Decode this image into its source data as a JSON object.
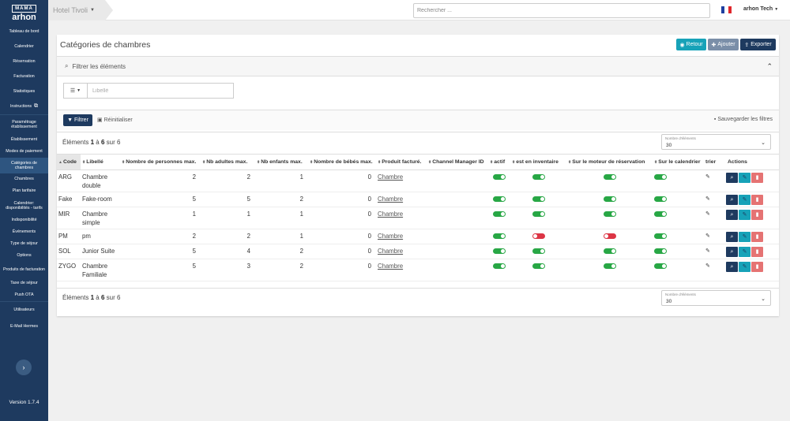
{
  "brand": {
    "line1": "MAMA",
    "line2": "arhon"
  },
  "sidebar": {
    "items": [
      {
        "label": "Tableau de bord",
        "height": 20
      },
      {
        "label": "Calendrier",
        "height": 19
      },
      {
        "label": "Réservation",
        "height": 19
      },
      {
        "label": "Facturation",
        "height": 19
      },
      {
        "label": "Statistiques",
        "height": 19
      },
      {
        "label": "Instructions",
        "height": 19,
        "icon": true
      },
      {
        "label": "Paramétrage établissement",
        "height": 25
      },
      {
        "label": "Établissement",
        "height": 15
      },
      {
        "label": "Modes de paiement",
        "height": 15
      },
      {
        "label": "Catégories de chambres",
        "height": 20
      },
      {
        "label": "Chambres",
        "height": 15
      },
      {
        "label": "Plan tarifaire",
        "height": 15
      },
      {
        "label": "Calendrier: disponibilités - tarifs",
        "height": 22
      },
      {
        "label": "Indisponibilité",
        "height": 15
      },
      {
        "label": "Événements",
        "height": 15
      },
      {
        "label": "Type de séjour",
        "height": 15
      },
      {
        "label": "Options",
        "height": 15
      },
      {
        "label": "Produits de facturation",
        "height": 20
      },
      {
        "label": "Taxe de séjour",
        "height": 15
      },
      {
        "label": "Push OTA",
        "height": 15
      },
      {
        "label": "Utilisateurs",
        "height": 22
      },
      {
        "label": "E-Mail Hermes",
        "height": 20
      }
    ],
    "version": "Version 1.7.4"
  },
  "topbar": {
    "hotel": "Hotel Tivoli",
    "search_placeholder": "Rechercher ...",
    "user": "arhon Tech"
  },
  "page": {
    "title": "Catégories de chambres",
    "btn_back": "Retour",
    "btn_add": "Ajouter",
    "btn_export": "Exporter"
  },
  "filters": {
    "title": "Filtrer les éléments",
    "input_placeholder": "Libellé",
    "btn_filter": "Filtrer",
    "btn_reset": "Réinitialiser",
    "btn_save": "Sauvegarder les filtres"
  },
  "pagination": {
    "prefix": "Éléments",
    "from": "1",
    "mid": "à",
    "to": "6",
    "suffix": "sur 6",
    "perpage_label": "Nombre d'éléments",
    "perpage_value": "30"
  },
  "table": {
    "columns": [
      "Code",
      "Libellé",
      "Nombre de personnes max.",
      "Nb adultes max.",
      "Nb enfants max.",
      "Nombre de bébés max.",
      "Produit facturé.",
      "Channel Manager ID",
      "actif",
      "est en inventaire",
      "Sur le moteur de réservation",
      "Sur le calendrier",
      "trier",
      "Actions"
    ],
    "rows": [
      {
        "code": "ARG",
        "label": "Chambre double",
        "pers": "2",
        "adults": "2",
        "children": "1",
        "babies": "0",
        "product": "Chambre",
        "cm": "",
        "actif": true,
        "inventaire": true,
        "moteur": true,
        "calendrier": true
      },
      {
        "code": "Fake",
        "label": "Fake-room",
        "pers": "5",
        "adults": "5",
        "children": "2",
        "babies": "0",
        "product": "Chambre",
        "cm": "",
        "actif": true,
        "inventaire": true,
        "moteur": true,
        "calendrier": true
      },
      {
        "code": "MIR",
        "label": "Chambre simple",
        "pers": "1",
        "adults": "1",
        "children": "1",
        "babies": "0",
        "product": "Chambre",
        "cm": "",
        "actif": true,
        "inventaire": true,
        "moteur": true,
        "calendrier": true
      },
      {
        "code": "PM",
        "label": "pm",
        "pers": "2",
        "adults": "2",
        "children": "1",
        "babies": "0",
        "product": "Chambre",
        "cm": "",
        "actif": true,
        "inventaire": false,
        "moteur": false,
        "calendrier": true
      },
      {
        "code": "SOL",
        "label": "Junior Suite",
        "pers": "5",
        "adults": "4",
        "children": "2",
        "babies": "0",
        "product": "Chambre",
        "cm": "",
        "actif": true,
        "inventaire": true,
        "moteur": true,
        "calendrier": true
      },
      {
        "code": "ZYGO",
        "label": "Chambre Familiale",
        "pers": "5",
        "adults": "3",
        "children": "2",
        "babies": "0",
        "product": "Chambre",
        "cm": "",
        "actif": true,
        "inventaire": true,
        "moteur": true,
        "calendrier": true
      }
    ]
  },
  "colors": {
    "sidebar": "#1e3a5f",
    "accent": "#17a2b8",
    "toggle_on": "#28a745",
    "toggle_off": "#dc3545"
  }
}
